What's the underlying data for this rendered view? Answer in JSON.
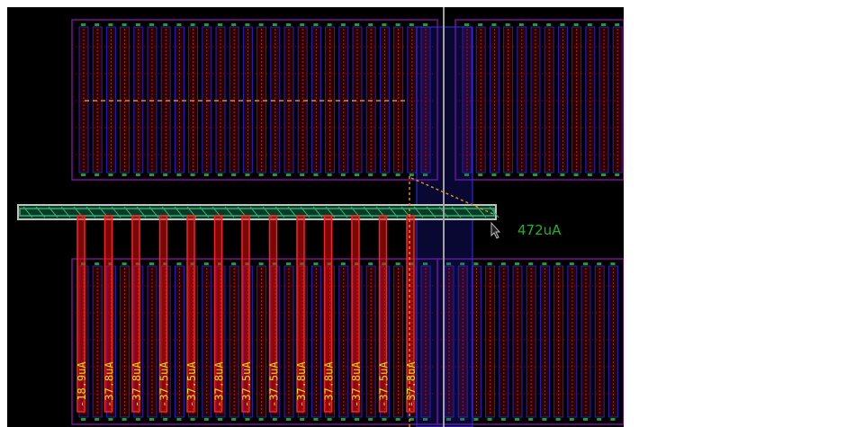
{
  "layout_view": {
    "total_current_label": "472uA",
    "finger_current_labels": [
      "-18.9uA",
      "-37.8uA",
      "-37.8uA",
      "-37.5uA",
      "-37.5uA",
      "-37.8uA",
      "-37.5uA",
      "-37.5uA",
      "-37.8uA",
      "-37.8uA",
      "-37.8uA",
      "-37.5uA",
      "-37.8uA"
    ],
    "colors": {
      "background": "#000000",
      "metal_bus": "#1c8a5a",
      "finger": "#e01010",
      "label": "#e8e000",
      "current_text": "#1fb51f",
      "poly": "#2020d0",
      "nwell": "#7a1090",
      "cursor_line": "#a0a0a0"
    }
  }
}
